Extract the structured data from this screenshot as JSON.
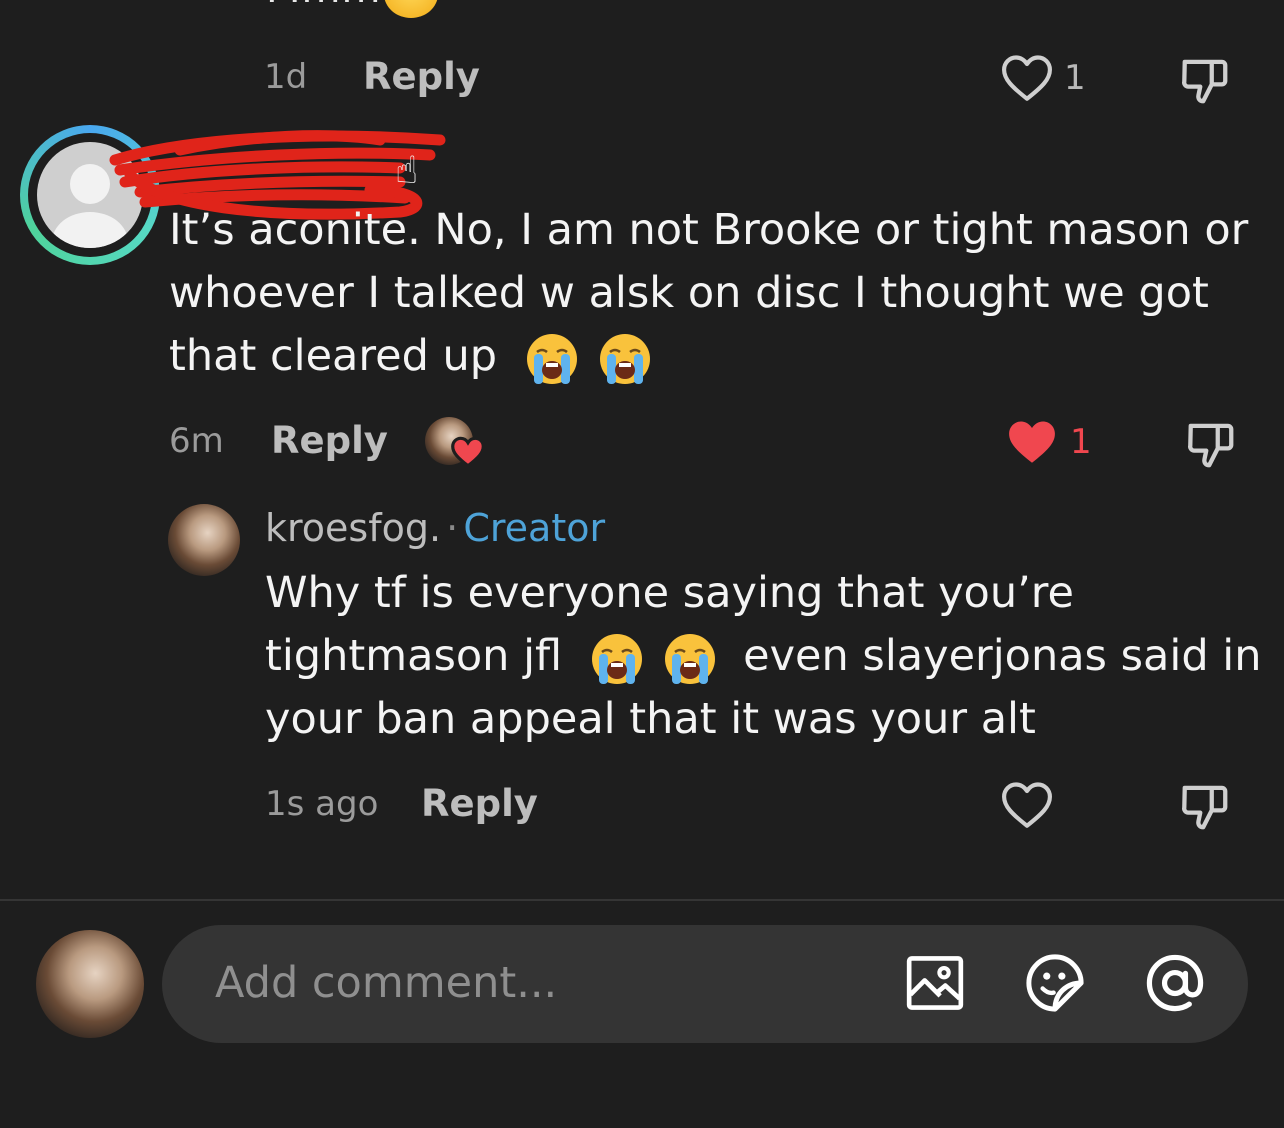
{
  "previous_comment": {
    "partial_text": "Mmm",
    "time": "1d",
    "reply_label": "Reply",
    "like_count": "1"
  },
  "comment": {
    "text_line1": "It’s aconite. No, I am not Brooke or tight mason or",
    "text_line2": "whoever I talked w alsk on disc I thought we got",
    "text_line3": "that cleared up",
    "time": "6m",
    "reply_label": "Reply",
    "like_count": "1",
    "liked": true
  },
  "reply": {
    "username": "kroesfog.",
    "separator": "·",
    "badge": "Creator",
    "text_line1": "Why tf is everyone saying that you’re",
    "text_line2a": "tightmason jfl",
    "text_line2b": "even slayerjonas said in",
    "text_line3": "your ban appeal that it was your alt",
    "time": "1s ago",
    "reply_label": "Reply"
  },
  "composer": {
    "placeholder": "Add comment..."
  },
  "colors": {
    "background": "#1e1e1e",
    "creator_badge": "#4ea3d8",
    "like_red": "#f0474f",
    "input_bg": "#343434"
  },
  "icons": [
    "heart-icon",
    "dislike-icon",
    "image-icon",
    "sticker-icon",
    "at-mention-icon",
    "crying-emoji",
    "pointing-up-emoji"
  ]
}
